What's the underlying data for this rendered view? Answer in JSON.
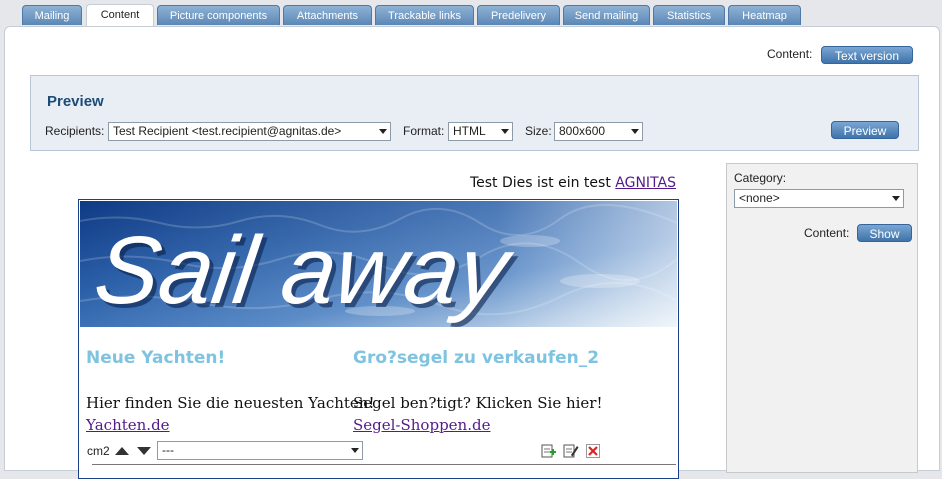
{
  "tabs": [
    {
      "label": "Mailing"
    },
    {
      "label": "Content"
    },
    {
      "label": "Picture components"
    },
    {
      "label": "Attachments"
    },
    {
      "label": "Trackable links"
    },
    {
      "label": "Predelivery"
    },
    {
      "label": "Send mailing"
    },
    {
      "label": "Statistics"
    },
    {
      "label": "Heatmap"
    }
  ],
  "active_tab": "Content",
  "content_toggle": {
    "label": "Content:",
    "button": "Text version"
  },
  "preview": {
    "title": "Preview",
    "recipients_label": "Recipients:",
    "recipients_value": "Test Recipient <test.recipient@agnitas.de>",
    "format_label": "Format:",
    "format_value": "HTML",
    "size_label": "Size:",
    "size_value": "800x600",
    "button": "Preview"
  },
  "sidebar": {
    "category_label": "Category:",
    "category_value": "<none>",
    "content_label": "Content:",
    "show_button": "Show"
  },
  "mailing": {
    "header_text": "Test Dies ist ein test",
    "header_link": "AGNITAS",
    "banner_text": "Sail away",
    "col1": {
      "title": "Neue Yachten!",
      "text": "Hier finden Sie die neuesten Yachten!",
      "link": "Yachten.de"
    },
    "col2": {
      "title": "Gro?segel zu verkaufen_2",
      "text": "Segel ben?tigt? Klicken Sie hier!",
      "link": "Segel-Shoppen.de"
    },
    "control": {
      "label": "cm2",
      "select_value": "---"
    }
  },
  "colors": {
    "accent": "#4a7db3",
    "title_blue": "#7ec3e0",
    "link": "#551a8b"
  }
}
